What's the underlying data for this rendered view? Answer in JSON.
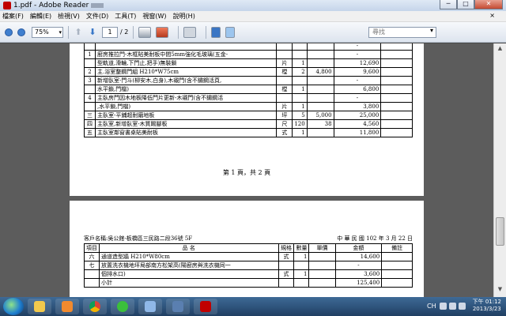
{
  "window": {
    "title": "1.pdf - Adobe Reader",
    "min_label": "─",
    "max_label": "□",
    "close_label": "✕"
  },
  "menu": {
    "items": [
      "檔案(F)",
      "編輯(E)",
      "檢視(V)",
      "文件(D)",
      "工具(T)",
      "視窗(W)",
      "說明(H)"
    ],
    "close_glyph": "×"
  },
  "toolbar": {
    "zoom": "75%",
    "page_current": "1",
    "page_total": "/ 2",
    "search_placeholder": "尋找",
    "search_dropdown": "▾"
  },
  "page1": {
    "rows": [
      {
        "item": "",
        "desc": "",
        "unit": "",
        "qty": "",
        "price": "",
        "amount": "-"
      },
      {
        "item": "1",
        "desc": "廚房推拉門-木框貼美耐板中間5mm強化毛玻璃(五金-",
        "unit": "",
        "qty": "",
        "price": "",
        "amount": "-"
      },
      {
        "item": "",
        "desc": "型軌道,滑輪,下門止,把手)無裝鎖",
        "unit": "片",
        "qty": "1",
        "price": "",
        "amount": "12,690"
      },
      {
        "item": "2",
        "desc": "主.浴室整鋼門組 H210*W75cm",
        "unit": "樘",
        "qty": "2",
        "price": "4,800",
        "amount": "9,600"
      },
      {
        "item": "3",
        "desc": "新增臥室-門斗(柳安木,白身),木襯門(含不鏽鋼活頁,",
        "unit": "",
        "qty": "",
        "price": "",
        "amount": "-"
      },
      {
        "item": "",
        "desc": "水平鎖,門檔)",
        "unit": "樘",
        "qty": "1",
        "price": "",
        "amount": "6,800"
      },
      {
        "item": "4",
        "desc": "主臥房門因木地板降低門片更新-木襯門(含不鏽鋼活",
        "unit": "",
        "qty": "",
        "price": "",
        "amount": "-"
      },
      {
        "item": "",
        "desc": ",水平鎖,門檔)",
        "unit": "片",
        "qty": "1",
        "price": "",
        "amount": "3,800"
      },
      {
        "item": "三",
        "desc": "主臥室-平鋪超耐磨地板",
        "unit": "坪",
        "qty": "5",
        "price": "5,000",
        "amount": "25,000"
      },
      {
        "item": "四",
        "desc": "主臥室,新增臥室-木質踢腳板",
        "unit": "尺",
        "qty": "120",
        "price": "38",
        "amount": "4,560"
      },
      {
        "item": "五",
        "desc": "主臥室鄰窗書桌貼美耐板",
        "unit": "式",
        "qty": "1",
        "price": "",
        "amount": "11,800"
      }
    ],
    "footer": "第 1 頁，共 2 頁"
  },
  "page2": {
    "customer": "客戶名稱:吳公館-板橋區三民路二段36號 5F",
    "date": "中 華 民 國    102  年   3  月  22  日",
    "headers": {
      "item": "項目",
      "desc": "品          名",
      "spec": "規格",
      "qty": "數量",
      "price": "單價",
      "amount": "金額",
      "note": "備註"
    },
    "rows": [
      {
        "item": "六",
        "desc": "通道造型牆 H210*W80cm",
        "unit": "式",
        "qty": "1",
        "price": "",
        "amount": "14,600"
      },
      {
        "item": "七",
        "desc": "放置洗衣機地坪局部南方松架高(陽廚房與洗衣機同一",
        "unit": "",
        "qty": "",
        "price": "",
        "amount": "-"
      },
      {
        "item": "",
        "desc": "個排水口)",
        "unit": "式",
        "qty": "1",
        "price": "",
        "amount": "3,600"
      },
      {
        "item": "",
        "desc": "小計",
        "unit": "",
        "qty": "",
        "price": "",
        "amount": "125,400"
      }
    ]
  },
  "taskbar": {
    "lang": "CH",
    "time": "下午 01:12",
    "date": "2013/3/23"
  },
  "colors": {
    "accent": "#3a78c8",
    "taskbar": "#203f63",
    "doc_bg": "#5c5c5c"
  }
}
